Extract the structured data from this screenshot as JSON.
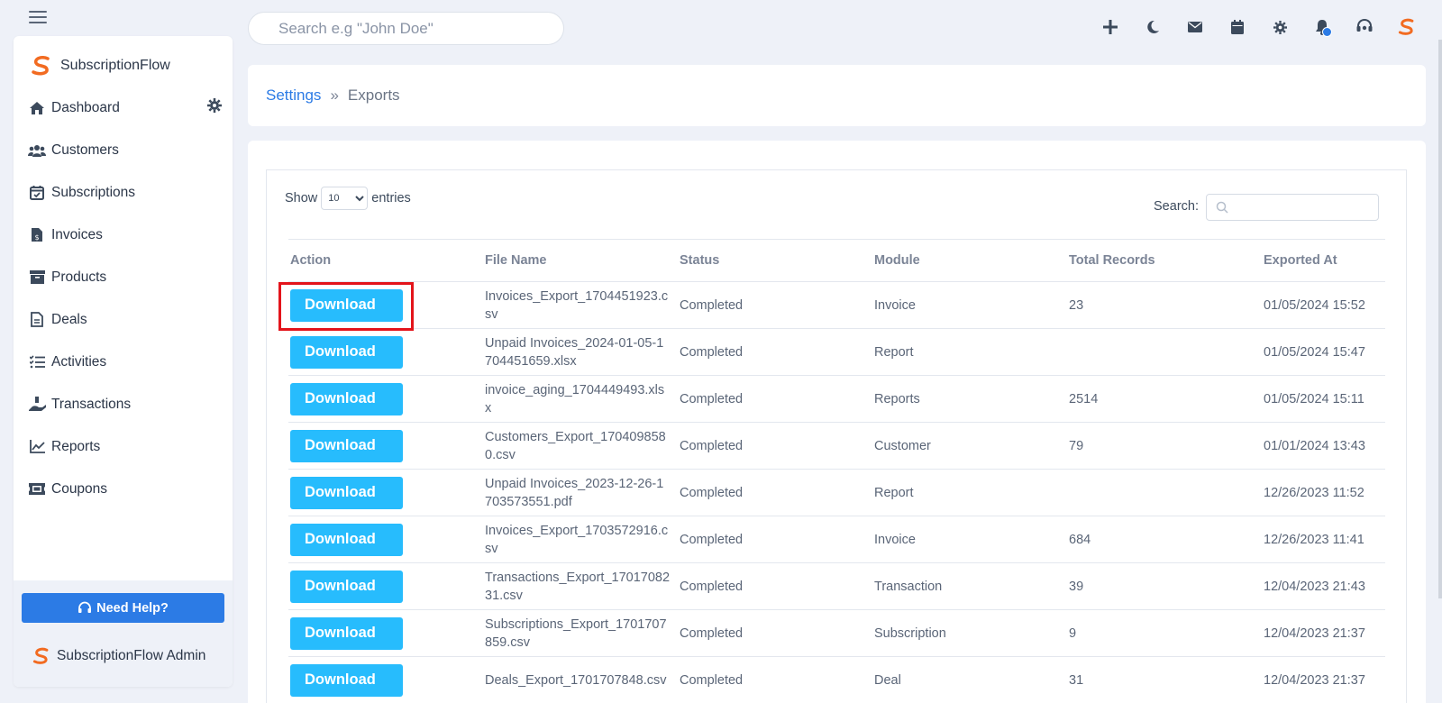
{
  "brand": {
    "name": "SubscriptionFlow",
    "admin": "SubscriptionFlow Admin"
  },
  "colors": {
    "accent": "#2c7be5",
    "download_button": "#27bcfd",
    "logo_orange": "#f26b21",
    "highlight": "#e3141b"
  },
  "search": {
    "placeholder": "Search e.g \"John Doe\""
  },
  "sidebar": {
    "items": [
      {
        "label": "Dashboard",
        "icon": "home-icon"
      },
      {
        "label": "Customers",
        "icon": "users-icon"
      },
      {
        "label": "Subscriptions",
        "icon": "calendar-check-icon"
      },
      {
        "label": "Invoices",
        "icon": "invoice-icon"
      },
      {
        "label": "Products",
        "icon": "archive-icon"
      },
      {
        "label": "Deals",
        "icon": "document-icon"
      },
      {
        "label": "Activities",
        "icon": "tasks-icon"
      },
      {
        "label": "Transactions",
        "icon": "hand-dollar-icon"
      },
      {
        "label": "Reports",
        "icon": "line-chart-icon"
      },
      {
        "label": "Coupons",
        "icon": "ticket-icon"
      }
    ],
    "help_label": "Need Help?"
  },
  "topbar": {
    "icons": [
      "plus-icon",
      "moon-icon",
      "mail-icon",
      "calendar-icon",
      "gear-icon",
      "bell-icon",
      "headset-icon",
      "logo-icon"
    ]
  },
  "breadcrumb": {
    "parent": "Settings",
    "separator": "»",
    "current": "Exports"
  },
  "table": {
    "show_label": "Show",
    "entries_label": "entries",
    "page_size": "10",
    "search_label": "Search:",
    "columns": [
      "Action",
      "File Name",
      "Status",
      "Module",
      "Total Records",
      "Exported At"
    ],
    "download_label": "Download",
    "rows": [
      {
        "file": "Invoices_Export_1704451923.csv",
        "status": "Completed",
        "module": "Invoice",
        "records": "23",
        "exported": "01/05/2024 15:52"
      },
      {
        "file": "Unpaid Invoices_2024-01-05-1704451659.xlsx",
        "status": "Completed",
        "module": "Report",
        "records": "",
        "exported": "01/05/2024 15:47"
      },
      {
        "file": "invoice_aging_1704449493.xlsx",
        "status": "Completed",
        "module": "Reports",
        "records": "2514",
        "exported": "01/05/2024 15:11"
      },
      {
        "file": "Customers_Export_1704098580.csv",
        "status": "Completed",
        "module": "Customer",
        "records": "79",
        "exported": "01/01/2024 13:43"
      },
      {
        "file": "Unpaid Invoices_2023-12-26-1703573551.pdf",
        "status": "Completed",
        "module": "Report",
        "records": "",
        "exported": "12/26/2023 11:52"
      },
      {
        "file": "Invoices_Export_1703572916.csv",
        "status": "Completed",
        "module": "Invoice",
        "records": "684",
        "exported": "12/26/2023 11:41"
      },
      {
        "file": "Transactions_Export_1701708231.csv",
        "status": "Completed",
        "module": "Transaction",
        "records": "39",
        "exported": "12/04/2023 21:43"
      },
      {
        "file": "Subscriptions_Export_1701707859.csv",
        "status": "Completed",
        "module": "Subscription",
        "records": "9",
        "exported": "12/04/2023 21:37"
      },
      {
        "file": "Deals_Export_1701707848.csv",
        "status": "Completed",
        "module": "Deal",
        "records": "31",
        "exported": "12/04/2023 21:37"
      }
    ]
  }
}
